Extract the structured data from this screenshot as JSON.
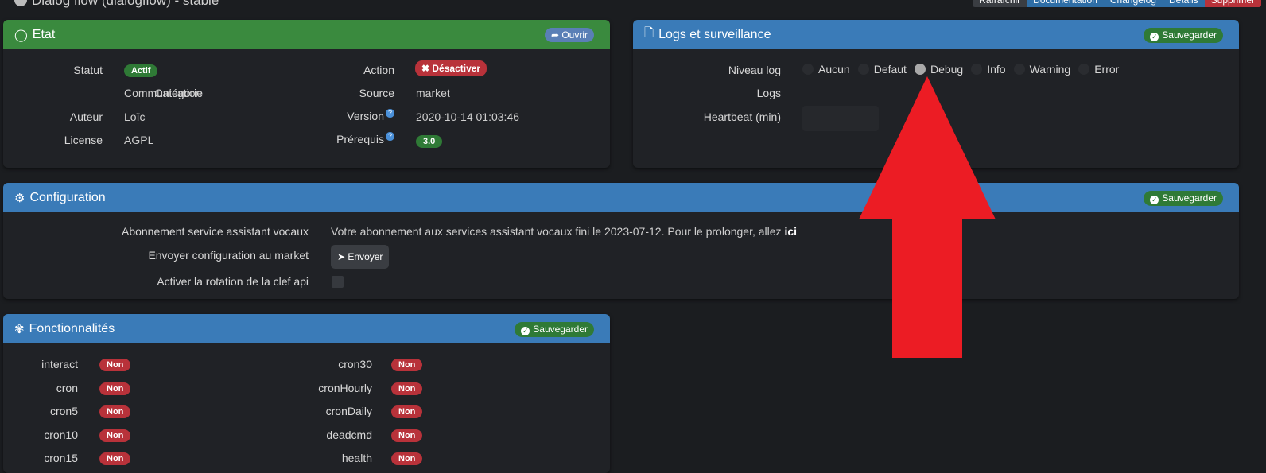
{
  "page": {
    "title": "Dialog flow (dialogflow) - stable"
  },
  "top_actions": [
    "Rafraîchir",
    "Documentation",
    "Changelog",
    "Détails",
    "Supprimer"
  ],
  "etat": {
    "title": "Etat",
    "open_label": "Ouvrir",
    "statut_label": "Statut",
    "statut_value": "Actif",
    "categorie_label": "Catégorie",
    "categorie_value": "Communication",
    "auteur_label": "Auteur",
    "auteur_value": "Loïc",
    "license_label": "License",
    "license_value": "AGPL",
    "action_label": "Action",
    "action_value": "Désactiver",
    "source_label": "Source",
    "source_value": "market",
    "version_label": "Version",
    "version_value": "2020-10-14 01:03:46",
    "prerequis_label": "Prérequis",
    "prerequis_value": "3.0"
  },
  "logs": {
    "title": "Logs et surveillance",
    "save_label": "Sauvegarder",
    "niveau_label": "Niveau log",
    "levels": [
      "Aucun",
      "Defaut",
      "Debug",
      "Info",
      "Warning",
      "Error"
    ],
    "selected_level": "Debug",
    "logs_label": "Logs",
    "heartbeat_label": "Heartbeat (min)"
  },
  "config": {
    "title": "Configuration",
    "save_label": "Sauvegarder",
    "abonnement_label": "Abonnement service assistant vocaux",
    "abonnement_text": "Votre abonnement aux services assistant vocaux fini le 2023-07-12. Pour le prolonger, allez",
    "abonnement_link": "ici",
    "envoyer_label": "Envoyer configuration au market",
    "envoyer_button": "Envoyer",
    "rotation_label": "Activer la rotation de la clef api"
  },
  "fonctionnalites": {
    "title": "Fonctionnalités",
    "save_label": "Sauvegarder",
    "left": [
      {
        "name": "interact",
        "value": "Non"
      },
      {
        "name": "cron",
        "value": "Non"
      },
      {
        "name": "cron5",
        "value": "Non"
      },
      {
        "name": "cron10",
        "value": "Non"
      },
      {
        "name": "cron15",
        "value": "Non"
      }
    ],
    "right": [
      {
        "name": "cron30",
        "value": "Non"
      },
      {
        "name": "cronHourly",
        "value": "Non"
      },
      {
        "name": "cronDaily",
        "value": "Non"
      },
      {
        "name": "deadcmd",
        "value": "Non"
      },
      {
        "name": "health",
        "value": "Non"
      }
    ]
  },
  "colors": {
    "green_header": "#3a8a3e",
    "blue_header": "#3a7bb8",
    "arrow": "#ec1c24",
    "background": "#1b1d20"
  }
}
